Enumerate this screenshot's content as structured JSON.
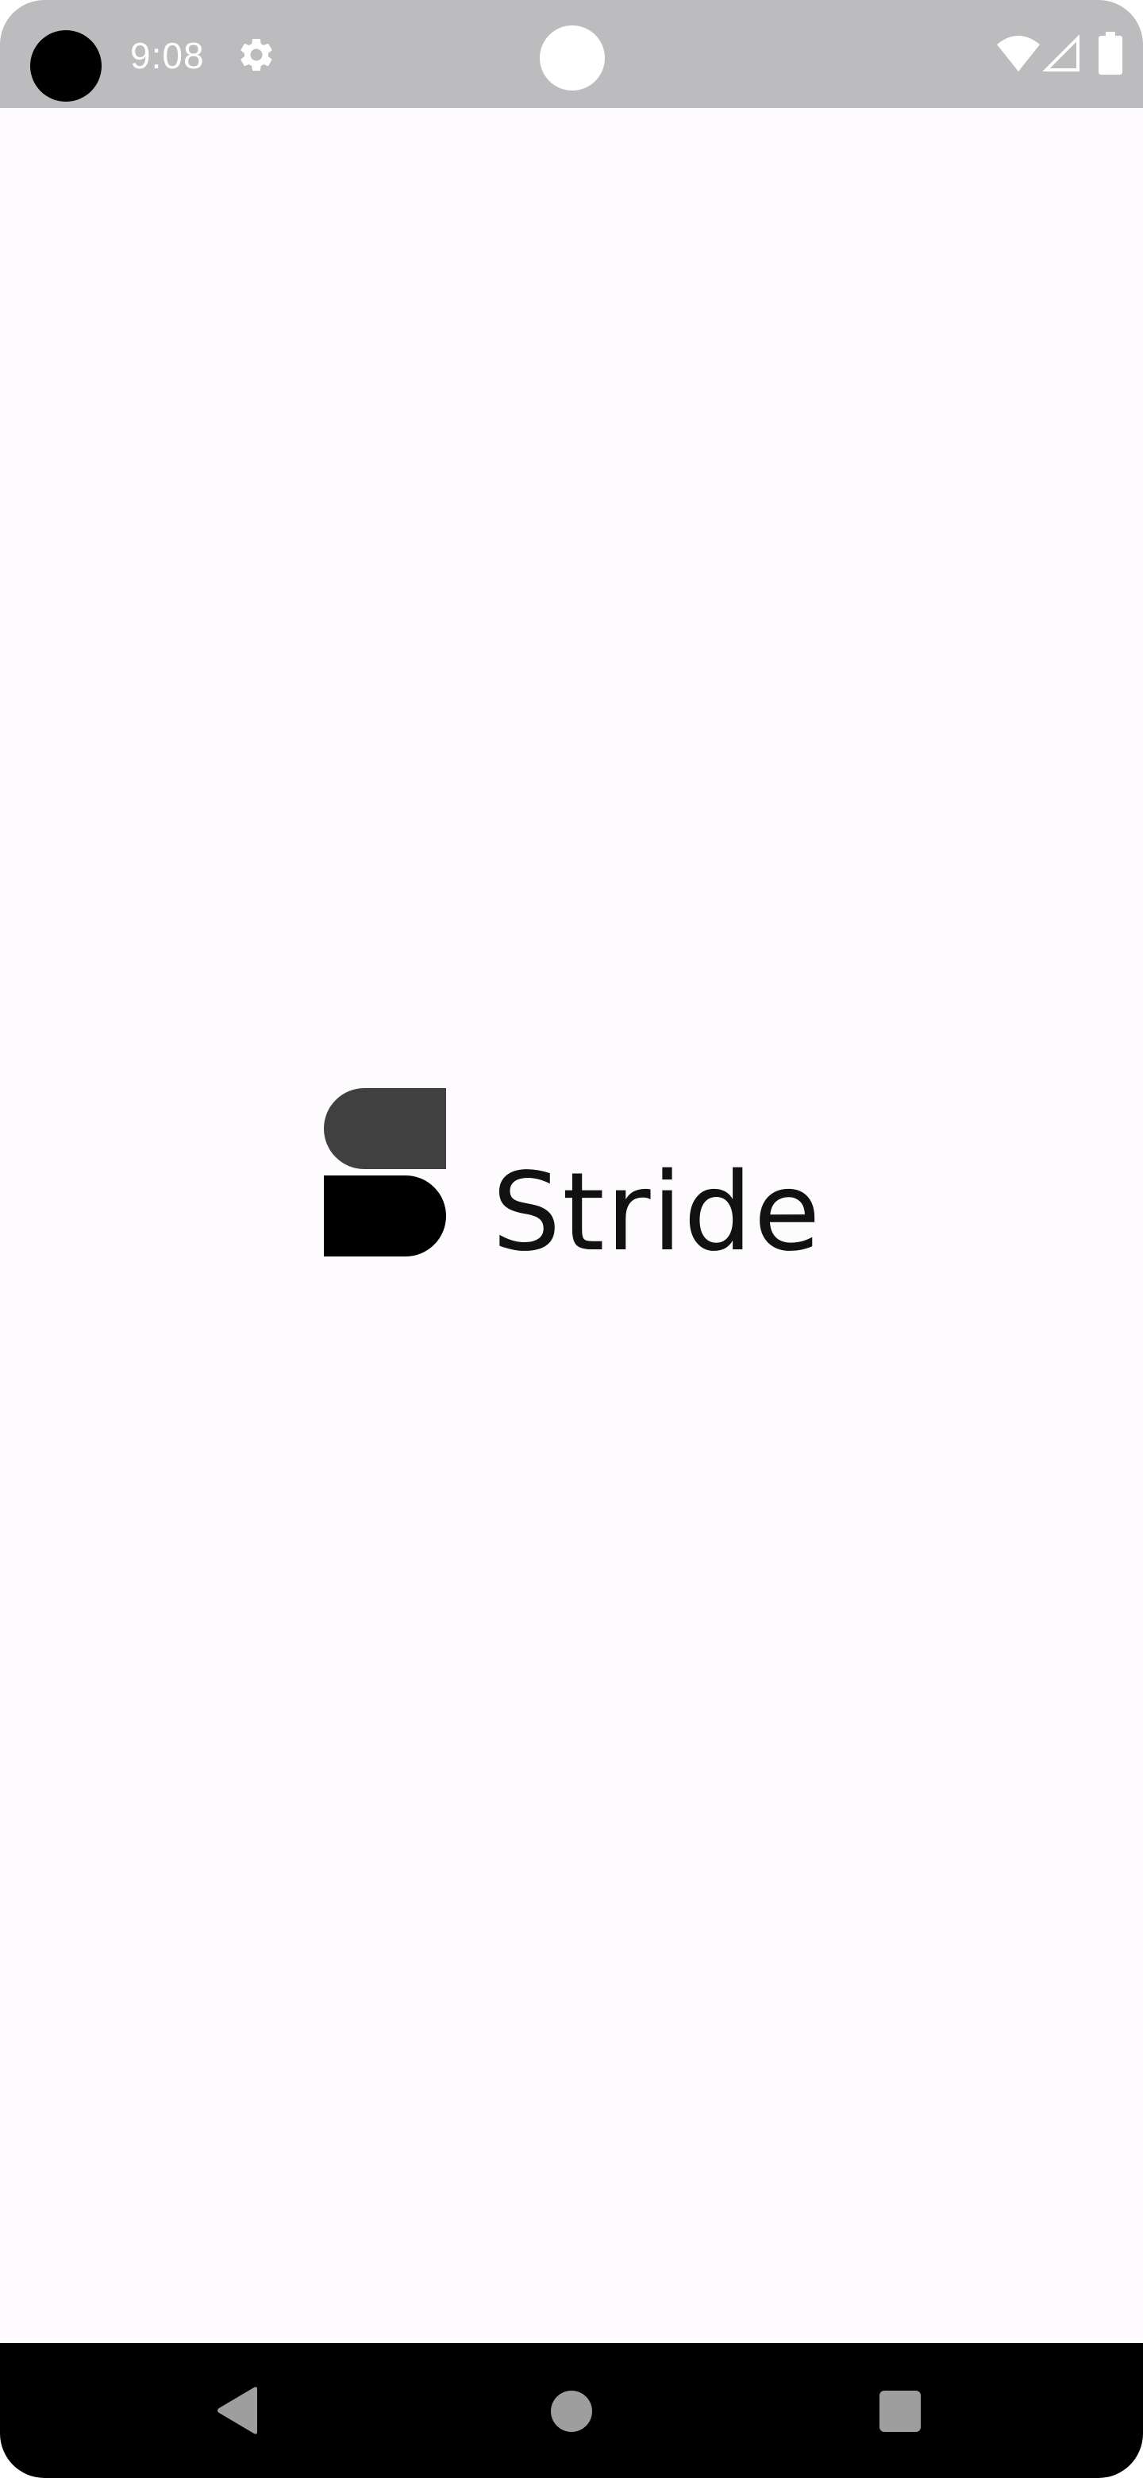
{
  "status_bar": {
    "time": "9:08",
    "icons": [
      "camera-cutout",
      "gear-icon",
      "notification-dot",
      "wifi-icon",
      "signal-icon",
      "battery-icon"
    ]
  },
  "splash": {
    "brand_name": "Stride",
    "logo": "stride-logo-mark"
  },
  "nav_bar": {
    "buttons": [
      "back-icon",
      "home-icon",
      "recents-icon"
    ]
  },
  "colors": {
    "status_bar_bg": "#bcbbbd",
    "screen_bg": "#fdfbfd",
    "logo_top": "#404040",
    "logo_bottom": "#000000",
    "nav_bar_bg": "#000000",
    "nav_icons": "#9e9e9e"
  }
}
